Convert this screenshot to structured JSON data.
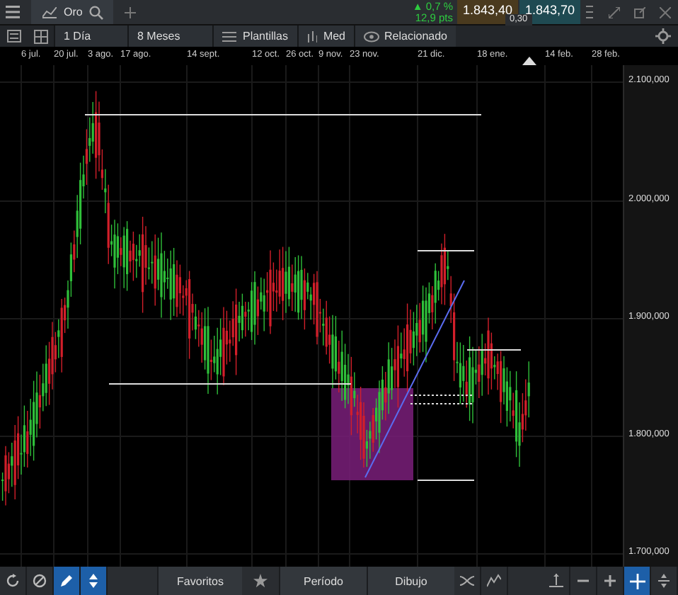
{
  "tab": {
    "title": "Oro",
    "selected": true
  },
  "quote": {
    "change": "▲ 0,7 %",
    "points": "12,9 pts",
    "sell": "1.843,40",
    "buy": "1.843,70",
    "spread": "0,30"
  },
  "toolbar": {
    "interval": "1 Día",
    "range": "8 Meses",
    "templates": "Plantillas",
    "indicators": "Med",
    "related": "Relacionado"
  },
  "x_labels": [
    "6 jul.",
    "20 jul.",
    "3 ago.",
    "17 ago.",
    "14 sept.",
    "12 oct.",
    "26 oct.",
    "9 nov.",
    "23 nov.",
    "21 dic.",
    "18 ene.",
    "14 feb.",
    "28 feb."
  ],
  "y_labels": [
    "2.100,000",
    "2.000,000",
    "1.900,000",
    "1.800,000",
    "1.700,000"
  ],
  "bottom_bar": {
    "left_tools": [
      {
        "selected": false
      },
      {
        "selected": false
      },
      {
        "selected": true
      },
      {
        "selected": true
      }
    ],
    "favorites": "Favoritos",
    "period": "Período",
    "drawing": "Dibujo",
    "right_tools": [
      {
        "selected": false
      },
      {
        "selected": false
      },
      {
        "selected": false
      },
      {
        "selected": true
      },
      {
        "selected": false
      }
    ]
  }
}
